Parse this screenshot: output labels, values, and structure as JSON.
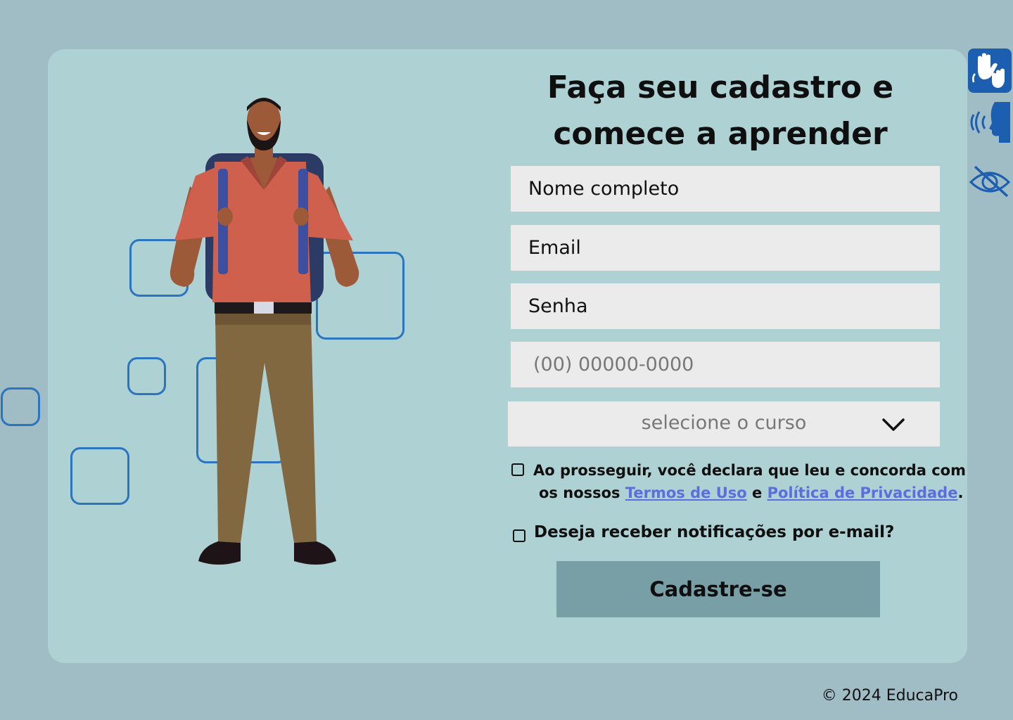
{
  "form": {
    "title_line1": "Faça seu cadastro e",
    "title_line2": "comece a aprender",
    "name_placeholder": "Nome completo",
    "email_placeholder": "Email",
    "password_placeholder": "Senha",
    "phone_placeholder": "(00) 00000-0000",
    "course_select": "selecione o curso",
    "terms_text_1": "Ao prosseguir, você declara que leu e concorda com",
    "terms_text_2": "os nossos",
    "terms_link": "Termos de Uso",
    "terms_and": "e",
    "privacy_link": "Política de Privacidade",
    "terms_end": ".",
    "notify_label": "Deseja receber notificações por e-mail?",
    "submit_label": "Cadastre-se"
  },
  "footer": {
    "copyright": "© 2024 EducaPro"
  },
  "accessibility": {
    "icons": [
      "sign-language-icon",
      "voice-reader-icon",
      "high-contrast-icon"
    ]
  },
  "colors": {
    "page_bg": "#a0bcc5",
    "card_bg": "#aed1d3",
    "input_bg": "#ebebeb",
    "button_bg": "#789ea6",
    "link": "#5b6ee0",
    "accent_blue": "#1c5fb0"
  }
}
